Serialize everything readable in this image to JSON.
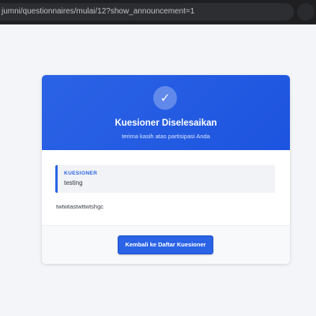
{
  "browser": {
    "url": "jumni/questionnaires/mulai/12?show_announcement=1"
  },
  "completion": {
    "check_icon": "✓",
    "title": "Kuesioner Diselesaikan",
    "subtitle": "terima kasih atas partisipasi Anda",
    "info_label": "KUESIONER",
    "info_value": "testing",
    "message": "twtwtastwttwtshgc",
    "back_button_label": "Kembali ke Daftar Kuesioner"
  },
  "colors": {
    "accent": "#2b63e6",
    "page_background": "#f3f5f8"
  }
}
